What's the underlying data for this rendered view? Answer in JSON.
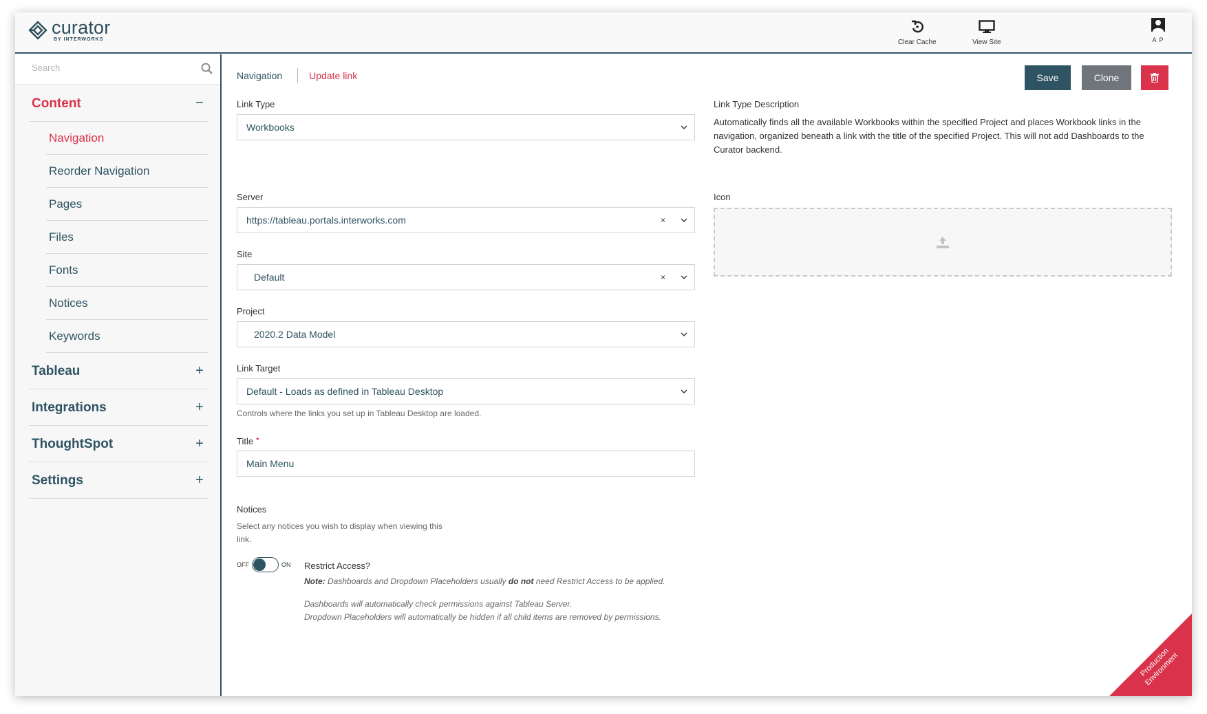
{
  "app": {
    "logo_word": "curator",
    "logo_sub": "BY INTERWORKS"
  },
  "topbar": {
    "clear_cache_label": "Clear Cache",
    "view_site_label": "View Site",
    "user_initials": "A P"
  },
  "sidebar": {
    "search_placeholder": "Search",
    "content_label": "Content",
    "content_toggle": "−",
    "items": [
      {
        "label": "Navigation",
        "active": true
      },
      {
        "label": "Reorder Navigation"
      },
      {
        "label": "Pages"
      },
      {
        "label": "Files"
      },
      {
        "label": "Fonts"
      },
      {
        "label": "Notices"
      },
      {
        "label": "Keywords"
      }
    ],
    "sections": [
      {
        "label": "Tableau",
        "toggle": "+"
      },
      {
        "label": "Integrations",
        "toggle": "+"
      },
      {
        "label": "ThoughtSpot",
        "toggle": "+"
      },
      {
        "label": "Settings",
        "toggle": "+"
      }
    ]
  },
  "breadcrumb": {
    "parent": "Navigation",
    "current": "Update link"
  },
  "toolbar": {
    "save_label": "Save",
    "clone_label": "Clone"
  },
  "form": {
    "link_type": {
      "label": "Link Type",
      "value": "Workbooks"
    },
    "server": {
      "label": "Server",
      "value": "https://tableau.portals.interworks.com",
      "clear": "×"
    },
    "site": {
      "label": "Site",
      "value": "Default",
      "clear": "×"
    },
    "project": {
      "label": "Project",
      "value": "2020.2 Data Model"
    },
    "link_target": {
      "label": "Link Target",
      "value": "Default - Loads as defined in Tableau Desktop",
      "help": "Controls where the links you set up in Tableau Desktop are loaded."
    },
    "title": {
      "label": "Title",
      "required_mark": "•",
      "value": "Main Menu"
    },
    "notices": {
      "label": "Notices",
      "help_line1": "Select any notices you wish to display when viewing this",
      "help_line2": "link."
    },
    "restrict_access": {
      "off_label": "OFF",
      "on_label": "ON",
      "title": "Restrict Access?",
      "note_prefix": "Note:",
      "note_part1": " Dashboards and Dropdown Placeholders usually ",
      "note_emphasis": "do not",
      "note_part2": " need Restrict Access to be applied.",
      "note_line2": "Dashboards will automatically check permissions against Tableau Server.",
      "note_line3": "Dropdown Placeholders will automatically be hidden if all child items are removed by permissions."
    }
  },
  "description": {
    "label": "Link Type Description",
    "text": "Automatically finds all the available Workbooks within the specified Project and places Workbook links in the navigation, organized beneath a link with the title of the specified Project. This will not add Dashboards to the Curator backend."
  },
  "icon_field": {
    "label": "Icon"
  },
  "environment": {
    "line1": "Production",
    "line2": "Environment"
  },
  "colors": {
    "brand_teal": "#2e5362",
    "accent_red": "#d9324a",
    "clone_gray": "#6f757b"
  }
}
